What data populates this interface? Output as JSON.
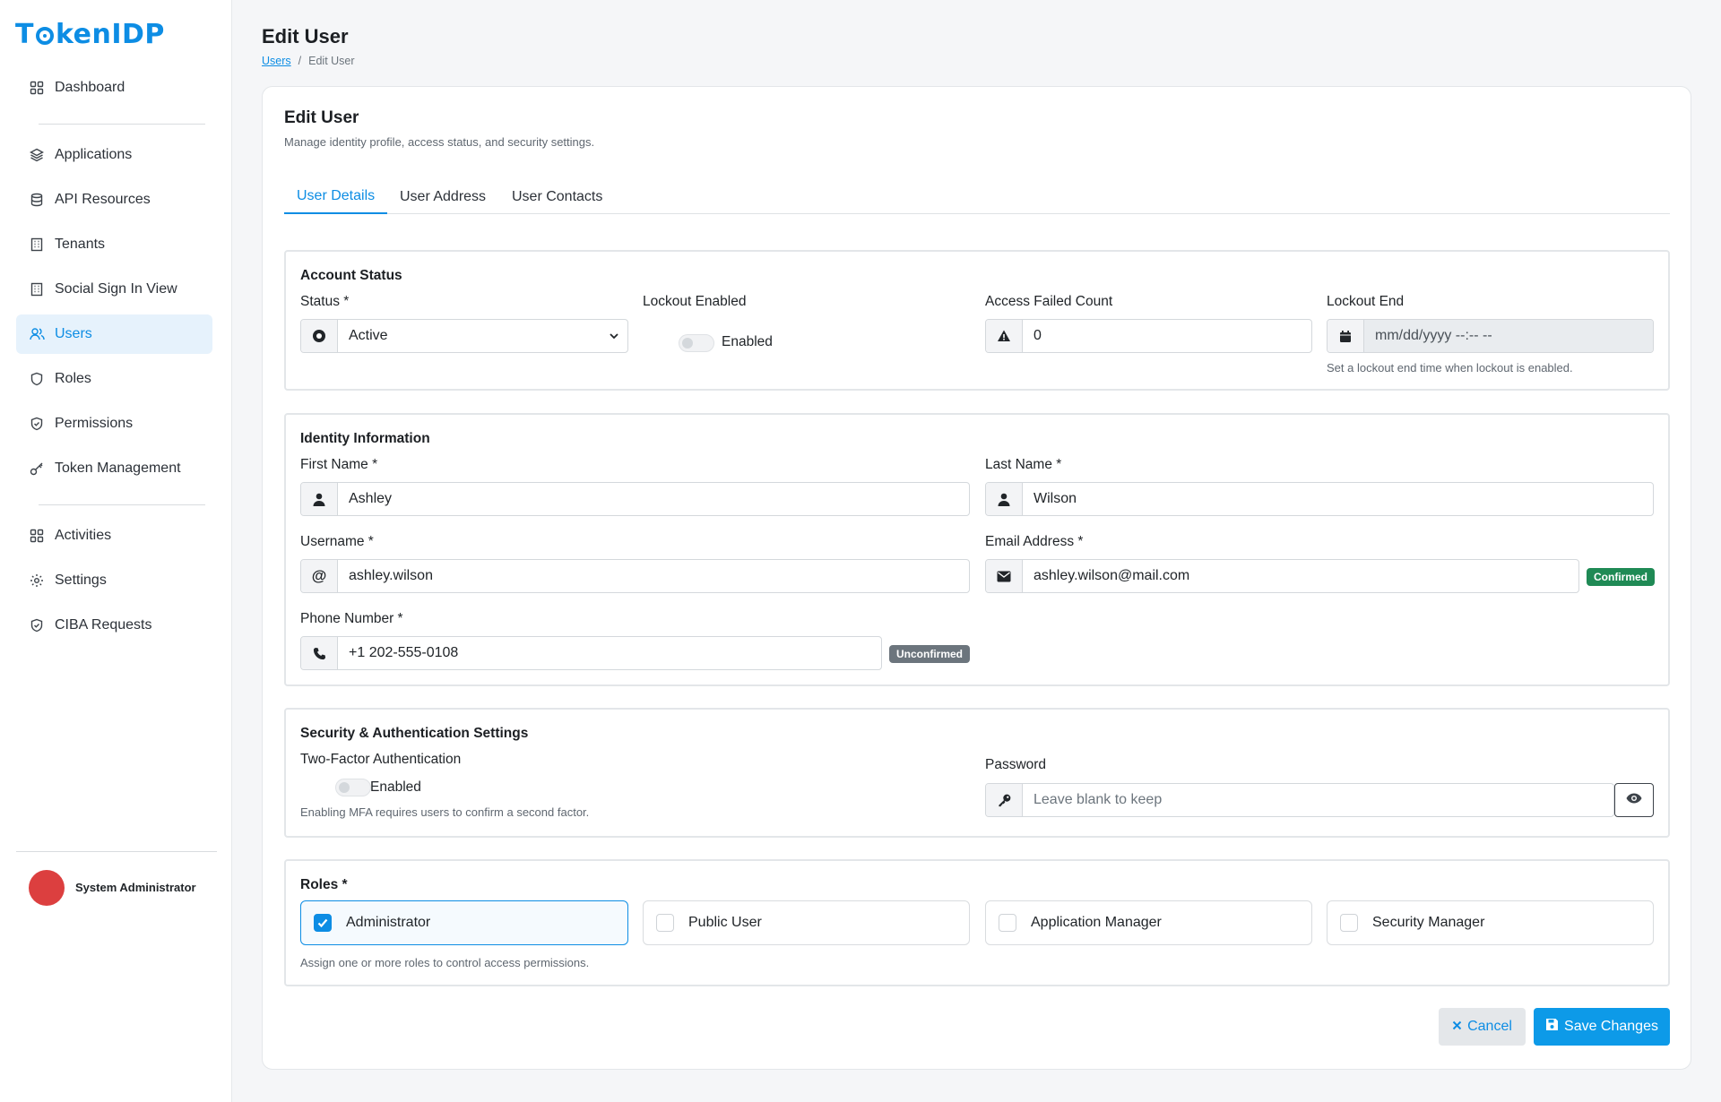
{
  "app": {
    "logo_text_1": "T",
    "logo_text_2": "kenIDP"
  },
  "sidebar": {
    "items": [
      {
        "label": "Dashboard",
        "icon": "grid-icon"
      },
      {
        "label": "Applications",
        "icon": "layers-icon"
      },
      {
        "label": "API Resources",
        "icon": "database-icon"
      },
      {
        "label": "Tenants",
        "icon": "building-icon"
      },
      {
        "label": "Social Sign In View",
        "icon": "building-icon"
      },
      {
        "label": "Users",
        "icon": "users-icon",
        "active": true
      },
      {
        "label": "Roles",
        "icon": "shield-icon"
      },
      {
        "label": "Permissions",
        "icon": "shield-check-icon"
      },
      {
        "label": "Token Management",
        "icon": "key-icon"
      },
      {
        "label": "Activities",
        "icon": "grid-icon"
      },
      {
        "label": "Settings",
        "icon": "gear-icon"
      },
      {
        "label": "CIBA Requests",
        "icon": "shield-check-icon"
      }
    ],
    "user_name": "System Administrator"
  },
  "header": {
    "title": "Edit User",
    "breadcrumb": [
      "Users",
      "/",
      "Edit User"
    ]
  },
  "card": {
    "title": "Edit User",
    "subtitle": "Manage identity profile, access status, and security settings.",
    "tabs": [
      "User Details",
      "User Address",
      "User Contacts"
    ],
    "active_tab": "User Details"
  },
  "account_status": {
    "title": "Account Status",
    "status_label": "Status *",
    "status_value": "Active",
    "lockout_label": "Lockout Enabled",
    "lockout_toggle_label": "Enabled",
    "lockout_enabled": false,
    "failed_label": "Access Failed Count",
    "failed_value": "0",
    "lockout_end_label": "Lockout End",
    "lockout_end_placeholder": "mm/dd/yyyy --:-- --",
    "lockout_end_hint": "Set a lockout end time when lockout is enabled."
  },
  "identity": {
    "title": "Identity Information",
    "first_name_label": "First Name *",
    "first_name": "Ashley",
    "last_name_label": "Last Name *",
    "last_name": "Wilson",
    "username_label": "Username *",
    "username": "ashley.wilson",
    "email_label": "Email Address *",
    "email": "ashley.wilson@mail.com",
    "email_badge": "Confirmed",
    "phone_label": "Phone Number *",
    "phone": "+1 202-555-0108",
    "phone_badge": "Unconfirmed"
  },
  "security": {
    "title": "Security & Authentication Settings",
    "mfa_label": "Two-Factor Authentication",
    "mfa_toggle_label": "Enabled",
    "mfa_enabled": false,
    "mfa_hint": "Enabling MFA requires users to confirm a second factor.",
    "password_label": "Password",
    "password_placeholder": "Leave blank to keep"
  },
  "roles": {
    "title": "Roles *",
    "options": [
      {
        "label": "Administrator",
        "checked": true
      },
      {
        "label": "Public User",
        "checked": false
      },
      {
        "label": "Application Manager",
        "checked": false
      },
      {
        "label": "Security Manager",
        "checked": false
      }
    ],
    "hint": "Assign one or more roles to control access permissions."
  },
  "actions": {
    "cancel_label": "Cancel",
    "save_label": "Save Changes"
  },
  "colors": {
    "accent": "#0d8de4",
    "confirmed": "#1f8a55",
    "unconfirmed": "#6c757d",
    "avatar": "#dc3f3f"
  }
}
